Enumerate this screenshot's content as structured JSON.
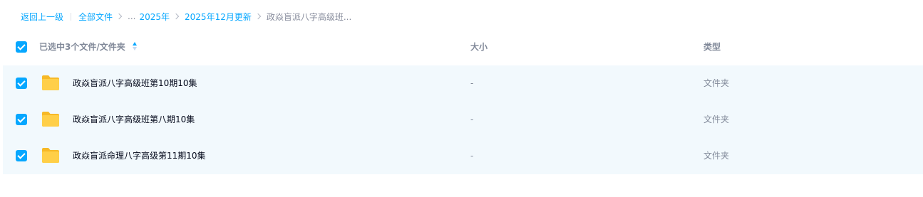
{
  "breadcrumb": {
    "back_label": "返回上一级",
    "root_label": "全部文件",
    "ellipsis": "...",
    "items": [
      "2025年",
      "2025年12月更新"
    ],
    "current": "政焱盲派八字高级班..."
  },
  "header": {
    "selection_label": "已选中3个文件/文件夹",
    "size_label": "大小",
    "type_label": "类型"
  },
  "files": [
    {
      "name": "政焱盲派八字高级班第10期10集",
      "size": "-",
      "type": "文件夹",
      "checked": true
    },
    {
      "name": "政焱盲派八字高级班第八期10集",
      "size": "-",
      "type": "文件夹",
      "checked": true
    },
    {
      "name": "政焱盲派命理八字高级第11期10集",
      "size": "-",
      "type": "文件夹",
      "checked": true
    }
  ],
  "colors": {
    "accent": "#06a7ff",
    "row_selected_bg": "#f2f9fd",
    "folder": "#ffc93d"
  },
  "icons": {
    "checkbox": "checkmark-icon",
    "sort": "sort-icon",
    "folder": "folder-icon",
    "separator": "chevron-right-icon"
  }
}
